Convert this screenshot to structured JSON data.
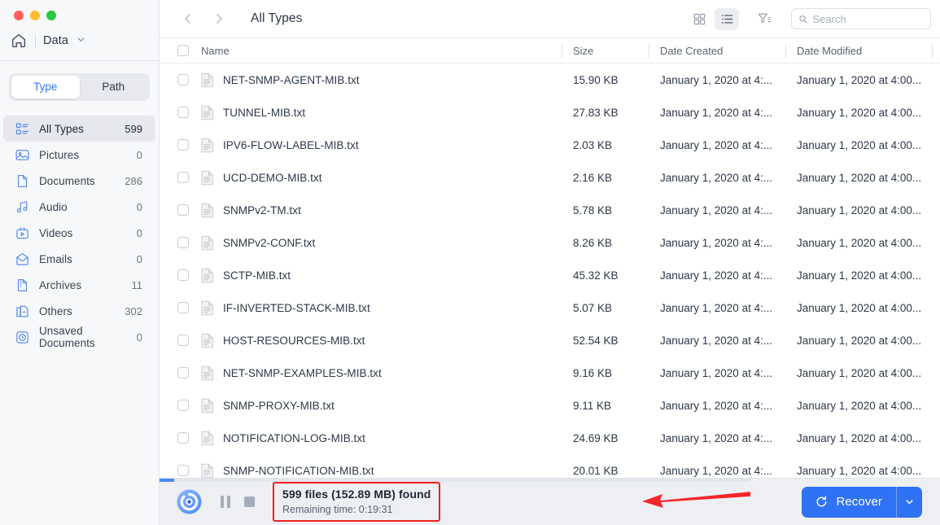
{
  "window": {
    "traffic_lights": [
      "close",
      "minimize",
      "maximize"
    ]
  },
  "sidebar": {
    "breadcrumb": {
      "home_icon": "home-icon",
      "label": "Data",
      "chevron": "chevron-down-icon"
    },
    "segmented": {
      "options": [
        "Type",
        "Path"
      ],
      "selected": "Type"
    },
    "categories": [
      {
        "icon": "all-types-icon",
        "label": "All Types",
        "count": "599",
        "active": true
      },
      {
        "icon": "picture-icon",
        "label": "Pictures",
        "count": "0",
        "active": false
      },
      {
        "icon": "document-icon",
        "label": "Documents",
        "count": "286",
        "active": false
      },
      {
        "icon": "audio-icon",
        "label": "Audio",
        "count": "0",
        "active": false
      },
      {
        "icon": "video-icon",
        "label": "Videos",
        "count": "0",
        "active": false
      },
      {
        "icon": "email-icon",
        "label": "Emails",
        "count": "0",
        "active": false
      },
      {
        "icon": "archive-icon",
        "label": "Archives",
        "count": "11",
        "active": false
      },
      {
        "icon": "others-icon",
        "label": "Others",
        "count": "302",
        "active": false
      },
      {
        "icon": "unsaved-document-icon",
        "label": "Unsaved Documents",
        "count": "0",
        "active": false
      }
    ]
  },
  "toolbar": {
    "back_icon": "chevron-left-icon",
    "forward_icon": "chevron-right-icon",
    "title": "All Types",
    "grid_view_icon": "grid-view-icon",
    "list_view_icon": "list-view-icon",
    "filter_icon": "filter-icon",
    "search": {
      "placeholder": "Search",
      "value": "",
      "icon": "search-icon"
    }
  },
  "table": {
    "columns": [
      "Name",
      "Size",
      "Date Created",
      "Date Modified"
    ],
    "rows": [
      {
        "name": "NET-SNMP-AGENT-MIB.txt",
        "size": "15.90 KB",
        "created": "January 1, 2020 at 4:...",
        "modified": "January 1, 2020 at 4:00..."
      },
      {
        "name": "TUNNEL-MIB.txt",
        "size": "27.83 KB",
        "created": "January 1, 2020 at 4:...",
        "modified": "January 1, 2020 at 4:00..."
      },
      {
        "name": "IPV6-FLOW-LABEL-MIB.txt",
        "size": "2.03 KB",
        "created": "January 1, 2020 at 4:...",
        "modified": "January 1, 2020 at 4:00..."
      },
      {
        "name": "UCD-DEMO-MIB.txt",
        "size": "2.16 KB",
        "created": "January 1, 2020 at 4:...",
        "modified": "January 1, 2020 at 4:00..."
      },
      {
        "name": "SNMPv2-TM.txt",
        "size": "5.78 KB",
        "created": "January 1, 2020 at 4:...",
        "modified": "January 1, 2020 at 4:00..."
      },
      {
        "name": "SNMPv2-CONF.txt",
        "size": "8.26 KB",
        "created": "January 1, 2020 at 4:...",
        "modified": "January 1, 2020 at 4:00..."
      },
      {
        "name": "SCTP-MIB.txt",
        "size": "45.32 KB",
        "created": "January 1, 2020 at 4:...",
        "modified": "January 1, 2020 at 4:00..."
      },
      {
        "name": "IF-INVERTED-STACK-MIB.txt",
        "size": "5.07 KB",
        "created": "January 1, 2020 at 4:...",
        "modified": "January 1, 2020 at 4:00..."
      },
      {
        "name": "HOST-RESOURCES-MIB.txt",
        "size": "52.54 KB",
        "created": "January 1, 2020 at 4:...",
        "modified": "January 1, 2020 at 4:00..."
      },
      {
        "name": "NET-SNMP-EXAMPLES-MIB.txt",
        "size": "9.16 KB",
        "created": "January 1, 2020 at 4:...",
        "modified": "January 1, 2020 at 4:00..."
      },
      {
        "name": "SNMP-PROXY-MIB.txt",
        "size": "9.11 KB",
        "created": "January 1, 2020 at 4:...",
        "modified": "January 1, 2020 at 4:00..."
      },
      {
        "name": "NOTIFICATION-LOG-MIB.txt",
        "size": "24.69 KB",
        "created": "January 1, 2020 at 4:...",
        "modified": "January 1, 2020 at 4:00..."
      },
      {
        "name": "SNMP-NOTIFICATION-MIB.txt",
        "size": "20.01 KB",
        "created": "January 1, 2020 at 4:...",
        "modified": "January 1, 2020 at 4:00..."
      }
    ]
  },
  "status": {
    "scan_icon": "scanning-disc-icon",
    "pause_icon": "pause-icon",
    "stop_icon": "stop-icon",
    "found_text": "599 files (152.89 MB) found",
    "remaining_text": "Remaining time: 0:19:31",
    "highlight_color": "#f01f1f",
    "progress_percent": 2
  },
  "footer": {
    "recover_label": "Recover",
    "recover_icon": "refresh-icon",
    "recover_caret_icon": "chevron-down-icon",
    "accent_color": "#2f72f4"
  },
  "annotation": {
    "arrow_icon": "arrow-left-icon",
    "color": "#f5252a"
  }
}
